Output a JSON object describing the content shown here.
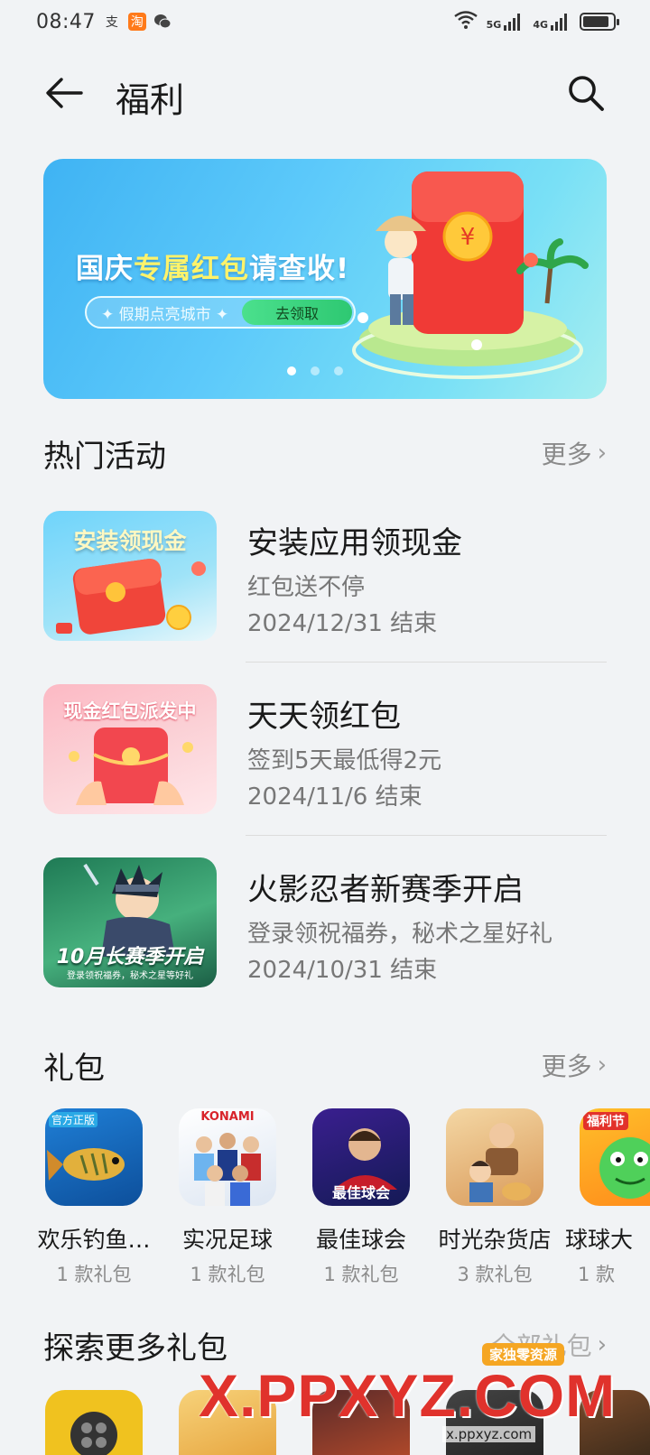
{
  "status": {
    "time": "08:47",
    "icons": [
      "alipay-icon",
      "taobao-icon",
      "wechat-icon",
      "wifi-icon",
      "signal-5g-icon",
      "signal-4g-icon",
      "battery-icon"
    ],
    "taobao_text": "淘",
    "alipay_text": "支",
    "net1": "5G",
    "net2": "4G"
  },
  "header": {
    "title": "福利"
  },
  "banner": {
    "headline_a": "国庆",
    "headline_b": "专属红包",
    "headline_c": "请查收!",
    "sub": "✦ 假期点亮城市 ✦",
    "cta": "去领取",
    "coin": "¥",
    "dots": 3,
    "active_dot": 0
  },
  "hot": {
    "title": "热门活动",
    "more": "更多",
    "items": [
      {
        "thumb_text": "安装领现金",
        "title": "安装应用领现金",
        "desc": "红包送不停",
        "date": "2024/12/31 结束"
      },
      {
        "thumb_text": "现金红包派发中",
        "title": "天天领红包",
        "desc": "签到5天最低得2元",
        "date": "2024/11/6 结束"
      },
      {
        "thumb_text": "10月长赛季开启",
        "thumb_sub": "登录领祝福券，秘术之星等好礼",
        "title": "火影忍者新赛季开启",
        "desc": "登录领祝福券，秘术之星好礼",
        "date": "2024/10/31 结束"
      }
    ]
  },
  "gifts": {
    "title": "礼包",
    "more": "更多",
    "items": [
      {
        "name": "欢乐钓鱼…",
        "count": "1 款礼包",
        "badge": "官方正版"
      },
      {
        "name": "实况足球",
        "count": "1 款礼包",
        "badge": "KONAMI"
      },
      {
        "name": "最佳球会",
        "count": "1 款礼包",
        "badge": "最佳球会"
      },
      {
        "name": "时光杂货店",
        "count": "3 款礼包",
        "badge": ""
      },
      {
        "name": "球球大",
        "count": "1 款",
        "badge": "福利节"
      }
    ]
  },
  "explore": {
    "title": "探索更多礼包",
    "all": "全部礼包"
  },
  "watermark": {
    "main": "X.PPXYZ.COM",
    "small": "x.ppxyz.com",
    "badge": "家独零资源"
  },
  "colors": {
    "background": "#f1f3f5",
    "red": "#f23a3a",
    "banner": "#4cbef6",
    "green": "#2ec872"
  }
}
